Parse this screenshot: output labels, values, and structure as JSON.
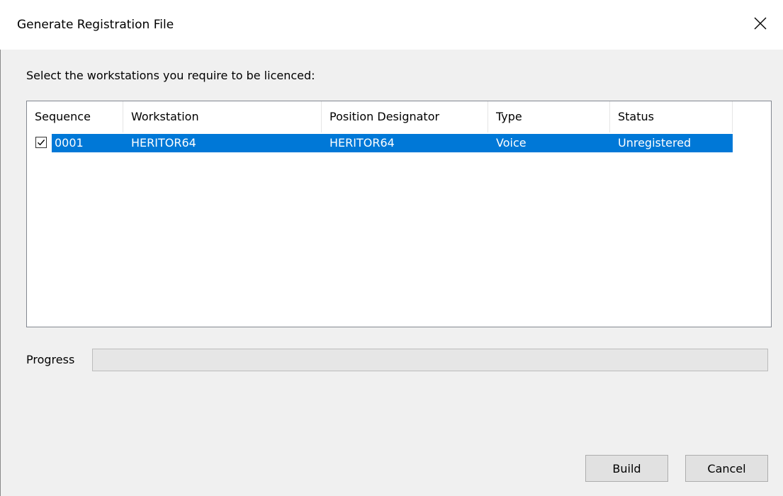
{
  "window": {
    "title": "Generate Registration File",
    "close_icon": "close-icon"
  },
  "instruction": "Select the workstations you require to be licenced:",
  "table": {
    "columns": [
      "Sequence",
      "Workstation",
      "Position Designator",
      "Type",
      "Status"
    ],
    "rows": [
      {
        "checked": true,
        "selected": true,
        "sequence": "0001",
        "workstation": "HERITOR64",
        "position_designator": "HERITOR64",
        "type": "Voice",
        "status": "Unregistered"
      }
    ]
  },
  "progress": {
    "label": "Progress",
    "value": 0
  },
  "buttons": {
    "build": "Build",
    "cancel": "Cancel"
  },
  "colors": {
    "selection": "#0078d7",
    "window_bg": "#f0f0f0"
  }
}
